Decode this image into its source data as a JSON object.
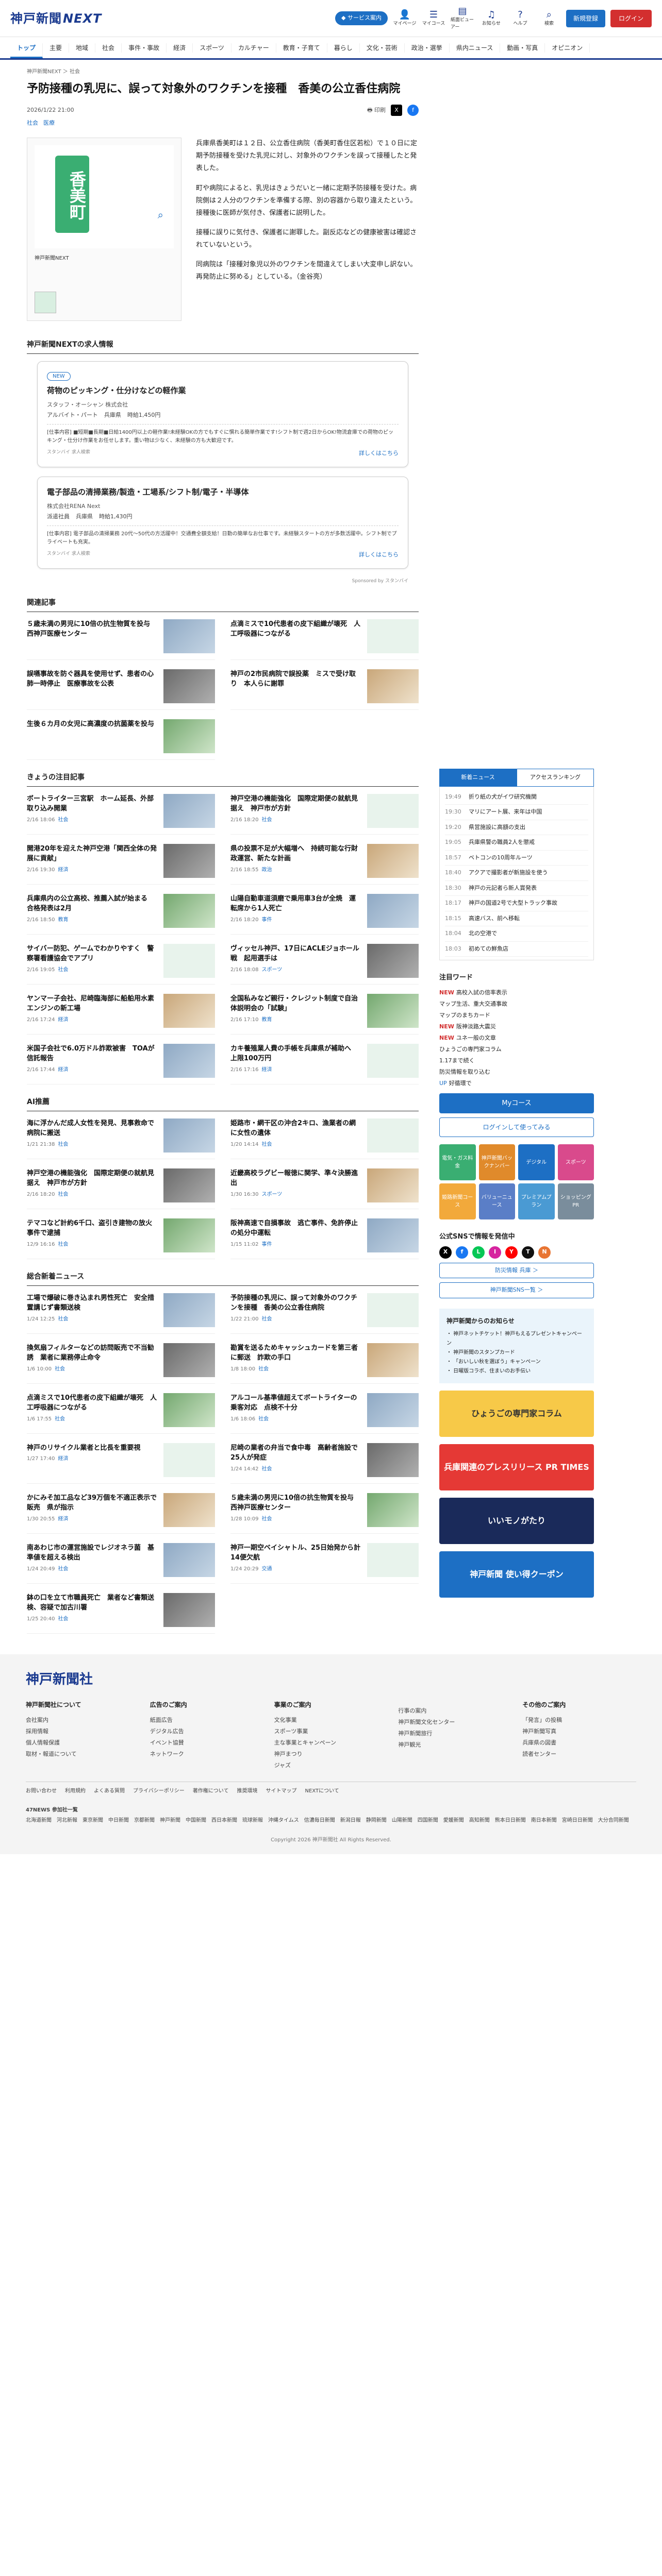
{
  "header": {
    "logo": "神戸新聞",
    "logo_next": "NEXT",
    "premium": "◆ サービス案内",
    "icons": [
      "マイページ",
      "マイコース",
      "紙面ビューアー",
      "お知らせ",
      "ヘルプ",
      "検索"
    ],
    "register": "新規登録",
    "login": "ログイン"
  },
  "nav": [
    "トップ",
    "主要",
    "地域",
    "社会",
    "事件・事故",
    "経済",
    "スポーツ",
    "カルチャー",
    "教育・子育て",
    "暮らし",
    "文化・芸術",
    "政治・選挙",
    "県内ニュース",
    "動画・写真",
    "オピニオン"
  ],
  "breadcrumb": "神戸新聞NEXT ＞ 社会",
  "article": {
    "title": "予防接種の乳児に、誤って対象外のワクチンを接種　香美の公立香住病院",
    "date": "2026/1/22 21:00",
    "print": "印刷",
    "tags": [
      "社会",
      "医療"
    ],
    "map_label": "香美町",
    "fig_caption": "神戸新聞NEXT",
    "paragraphs": [
      "兵庫県香美町は１２日、公立香住病院（香美町香住区若松）で１０日に定期予防接種を受けた乳児に対し、対象外のワクチンを誤って接種したと発表した。",
      "町や病院によると、乳児はきょうだいと一緒に定期予防接種を受けた。病院側は２人分のワクチンを準備する際、別の容器から取り違えたという。接種後に医師が気付き、保護者に説明した。",
      "接種に誤りに気付き、保護者に謝罪した。副反応などの健康被害は確認されていないという。",
      "同病院は「接種対象児以外のワクチンを間違えてしまい大変申し訳ない。再発防止に努める」としている。（金谷亮）"
    ]
  },
  "jobs": {
    "heading": "神戸新聞NEXTの求人情報",
    "items": [
      {
        "badge": "NEW",
        "title": "荷物のピッキング・仕分けなどの軽作業",
        "company": "スタッフ・オーシャン 株式会社",
        "cond": [
          "アルバイト・パート",
          "兵庫県",
          "時給1,450円"
        ],
        "desc": "[仕事内容] ■短期■長期■日給1400円以上の軽作業!未経験OKの方でもすぐに慣れる簡単作業です!シフト制で週2日からOK!物流倉庫での荷物のピッキング・仕分け作業をお任せします。重い物は少なく、未経験の方も大歓迎です。",
        "site": "スタンバイ 求人検索",
        "more": "詳しくはこちら"
      },
      {
        "badge": "",
        "title": "電子部品の清掃業務/製造・工場系/シフト制/電子・半導体",
        "company": "株式会社RENA Next",
        "cond": [
          "派遣社員",
          "兵庫県",
          "時給1,430円"
        ],
        "desc": "[仕事内容] 電子部品の清掃業務 20代〜50代の方活躍中！交通費全額支給！日勤の簡単なお仕事です。未経験スタートの方が多数活躍中。シフト制でプライベートも充実。",
        "site": "スタンバイ 求人検索",
        "more": "詳しくはこちら"
      }
    ],
    "sponsor": "Sponsored by スタンバイ"
  },
  "related": {
    "heading": "関連記事",
    "items": [
      {
        "title": "５歳未満の男児に10倍の抗生物質を投与　西神戸医療センター",
        "date": ""
      },
      {
        "title": "点滴ミスで10代患者の皮下組織が壊死　人工呼吸器につながる",
        "date": ""
      },
      {
        "title": "誤嚥事故を防ぐ器具を使用せず、患者の心肺一時停止　医療事故を公表",
        "date": ""
      },
      {
        "title": "神戸の2市民病院で誤投薬　ミスで受け取り　本人らに謝罪",
        "date": ""
      },
      {
        "title": "生後６カ月の女児に高濃度の抗菌薬を投与",
        "date": ""
      }
    ]
  },
  "today": {
    "heading": "きょうの注目記事",
    "items": [
      {
        "title": "ボートライター三宮駅　ホーム延長、外部取り込み開業",
        "date": "2/16 18:06",
        "cat": "社会"
      },
      {
        "title": "神戸空港の機能強化　国際定期便の就航見据え　神戸市が方針",
        "date": "2/16 18:20",
        "cat": "社会"
      },
      {
        "title": "開港20年を迎えた神戸空港「関西全体の発展に貢献」",
        "date": "2/16 19:30",
        "cat": "経済"
      },
      {
        "title": "県の投票不足が大幅増へ　持続可能な行財政運営、新たな計画",
        "date": "2/16 18:55",
        "cat": "政治"
      },
      {
        "title": "兵庫県内の公立高校、推薦入試が始まる　合格発表は2月",
        "date": "2/16 18:50",
        "cat": "教育"
      },
      {
        "title": "山陽自動車道須磨で乗用車3台が全焼　運転席から1人死亡",
        "date": "2/16 18:20",
        "cat": "事件"
      },
      {
        "title": "サイバー防犯、ゲームでわかりやすく　警察署看護協会でアプリ",
        "date": "2/16 19:05",
        "cat": "社会"
      },
      {
        "title": "ヴィッセル神戸、17日にACLEジョホール戦　起用選手は",
        "date": "2/16 18:08",
        "cat": "スポーツ"
      },
      {
        "title": "ヤンマー子会社、尼崎臨海部に船舶用水素エンジンの新工場",
        "date": "2/16 17:24",
        "cat": "経済"
      },
      {
        "title": "全国私みなど親行・クレジット制度で自治体説明会の「試験」",
        "date": "2/16 17:10",
        "cat": "教育"
      },
      {
        "title": "米国子会社で6.0万ドル詐欺被害　TOAが信託報告",
        "date": "2/16 17:44",
        "cat": "経済"
      },
      {
        "title": "カキ養殖業人費の手帳を兵庫県が補助へ　上限100万円",
        "date": "2/16 17:16",
        "cat": "経済"
      }
    ]
  },
  "ai": {
    "heading": "AI推薦",
    "items": [
      {
        "title": "海に浮かんだ成人女性を発見、見事救命で病院に搬送",
        "date": "1/21 21:38",
        "cat": "社会"
      },
      {
        "title": "姫路市・網干区の沖合2キロ、漁業者の網に女性の遺体",
        "date": "1/20 14:14",
        "cat": "社会"
      },
      {
        "title": "神戸空港の機能強化　国際定期便の就航見据え　神戸市が方針",
        "date": "2/16 18:20",
        "cat": "社会"
      },
      {
        "title": "近畿高校ラグビー報徳に関学、準々決勝進出",
        "date": "1/30 16:30",
        "cat": "スポーツ"
      },
      {
        "title": "テマコなど計約6千口、盗引き建物の放火事件で逮捕",
        "date": "12/9 16:16",
        "cat": "社会"
      },
      {
        "title": "阪神高速で自損事故　逃亡事件、免許停止の処分中運転",
        "date": "1/15 11:02",
        "cat": "事件"
      }
    ]
  },
  "general": {
    "heading": "総合新着ニュース",
    "items": [
      {
        "title": "工場で爆破に巻き込まれ男性死亡　安全措置講じず書類送検",
        "date": "1/24 12:25",
        "cat": "社会"
      },
      {
        "title": "予防接種の乳児に、誤って対象外のワクチンを接種　香美の公立香住病院",
        "date": "1/22 21:00",
        "cat": "社会"
      },
      {
        "title": "換気扇フィルターなどの訪問販売で不当勧誘　業者に業務停止命令",
        "date": "1/6 10:00",
        "cat": "社会"
      },
      {
        "title": "勘賞を送るためキャッシュカードを第三者に郵送　詐欺の手口",
        "date": "1/8 18:00",
        "cat": "社会"
      },
      {
        "title": "点滴ミスで10代患者の皮下組織が壊死　人工呼吸器につながる",
        "date": "1/6 17:55",
        "cat": "社会"
      },
      {
        "title": "アルコール基準値超えてボートライターの乗客対応　点検不十分",
        "date": "1/6 18:06",
        "cat": "社会"
      },
      {
        "title": "神戸のリサイクル業者と比長を重要視",
        "date": "1/27 17:40",
        "cat": "経済"
      },
      {
        "title": "尼崎の業者の弁当で食中毒　高齢者施設で25人が発症",
        "date": "1/24 14:42",
        "cat": "社会"
      },
      {
        "title": "かにみそ加工品など39万個を不適正表示で販売　県が指示",
        "date": "1/30 20:55",
        "cat": "経済"
      },
      {
        "title": "５歳未満の男児に10倍の抗生物質を投与　西神戸医療センター",
        "date": "1/28 10:09",
        "cat": "社会"
      },
      {
        "title": "南あわじ市の運営施設でレジオネラ菌　基準値を超える検出",
        "date": "1/24 20:49",
        "cat": "社会"
      },
      {
        "title": "神戸一期空ベイシャトル、25日始発から計14便欠航",
        "date": "1/24 20:29",
        "cat": "交通"
      },
      {
        "title": "鉢の口を立て市職員死亡　業者など書類送検、容疑で加古川署",
        "date": "1/25 20:40",
        "cat": "社会"
      }
    ]
  },
  "sidebar": {
    "tabs": [
      "新着ニュース",
      "アクセスランキング"
    ],
    "ranking": [
      {
        "t": "19:49",
        "txt": "折り紙の犬がイワ研究機関"
      },
      {
        "t": "19:30",
        "txt": "マリにアート展、来年は中国"
      },
      {
        "t": "19:20",
        "txt": "県営施設に高額の支出"
      },
      {
        "t": "19:05",
        "txt": "兵庫県警の職員2人を懲戒"
      },
      {
        "t": "18:57",
        "txt": "ベトコンの10周年ルーツ"
      },
      {
        "t": "18:40",
        "txt": "アクアで撮影者が新施設を使う"
      },
      {
        "t": "18:30",
        "txt": "神戸の元記者ら新人賞発表"
      },
      {
        "t": "18:17",
        "txt": "神戸の国道2号で大型トラック事故"
      },
      {
        "t": "18:15",
        "txt": "高速バス、前へ移転"
      },
      {
        "t": "18:04",
        "txt": "北の空港で"
      },
      {
        "t": "18:03",
        "txt": "初めての鮮魚店"
      }
    ],
    "kw_heading": "注目ワード",
    "keywords": [
      {
        "tag": "NEW",
        "txt": "高校入試の倍率表示"
      },
      {
        "tag": "",
        "txt": "マップ生活、重大交通事故"
      },
      {
        "tag": "",
        "txt": "マップのまちカード"
      },
      {
        "tag": "NEW",
        "txt": "阪神淡路大震災"
      },
      {
        "tag": "NEW",
        "txt": "ユネ一般の文章"
      },
      {
        "tag": "",
        "txt": "ひょうごの専門家コラム"
      },
      {
        "tag": "",
        "txt": "1.17まで続く"
      },
      {
        "tag": "",
        "txt": "防災情報を取り込む"
      },
      {
        "tag": "UP",
        "txt": "好循環で"
      }
    ],
    "mycourse": "Myコース",
    "login_btn": "ログインして使ってみる",
    "color_btns": [
      "電気・ガス料金",
      "神戸新聞バックナンバー",
      "デジタル",
      "スポーツ"
    ],
    "color_btns2": [
      "姫路新聞コース",
      "バリューニュース",
      "プレミアムプラン",
      "ショッピングPR"
    ],
    "sns_heading": "公式SNSで情報を発信中",
    "sns": [
      "X",
      "f",
      "L",
      "I",
      "Y",
      "T",
      "N"
    ],
    "news_btn1": "防災情報 兵庫 ＞",
    "news_btn2": "神戸新聞SNS一覧 ＞",
    "info_title": "神戸新聞からのお知らせ",
    "info": [
      "・ 神戸ネットチケット！神戸もえるプレゼントキャンペーン",
      "・ 神戸新聞のスタンプカード",
      "・ 「おいしい秋を選ぼう」キャンペーン",
      "・ 日曜版コラボ、住まいのお手伝い"
    ],
    "banner1": "ひょうごの専門家コラム",
    "banner2": "兵庫関連のプレスリリース PR TIMES",
    "banner3": "いいモノがたり",
    "banner4": "神戸新聞 使い得クーポン"
  },
  "footer": {
    "logo": "神戸新聞社",
    "cols": [
      {
        "h": "神戸新聞社について",
        "items": [
          "会社案内",
          "採用情報",
          "個人情報保護",
          "取材・報道について"
        ]
      },
      {
        "h": "広告のご案内",
        "items": [
          "紙面広告",
          "デジタル広告",
          "イベント協賛",
          "ネットワーク"
        ]
      },
      {
        "h": "事業のご案内",
        "items": [
          "文化事業",
          "スポーツ事業",
          "主な事業とキャンペーン",
          "神戸まつり",
          "ジャズ"
        ]
      },
      {
        "h": "",
        "items": [
          "行事の案内",
          "神戸新聞文化センター",
          "神戸新聞旅行",
          "神戸観光"
        ]
      },
      {
        "h": "その他のご案内",
        "items": [
          "「発言」の投稿",
          "神戸新聞写真",
          "兵庫県の図書",
          "読者センター"
        ]
      }
    ],
    "bottom": [
      "お問い合わせ",
      "利用規約",
      "よくある質問",
      "プライバシーポリシー",
      "著作権について",
      "推奨環境",
      "サイトマップ",
      "NEXTについて"
    ],
    "news47_title": "47NEWS 参加社一覧",
    "news47": "北海道新聞　河北新報　東京新聞　中日新聞　京都新聞　神戸新聞　中国新聞　西日本新聞　琉球新報　沖縄タイムス　信濃毎日新聞　新潟日報　静岡新聞　山陽新聞　四国新聞　愛媛新聞　高知新聞　熊本日日新聞　南日本新聞　宮崎日日新聞　大分合同新聞",
    "copyright": "Copyright 2026 神戸新聞社 All Rights Reserved."
  }
}
